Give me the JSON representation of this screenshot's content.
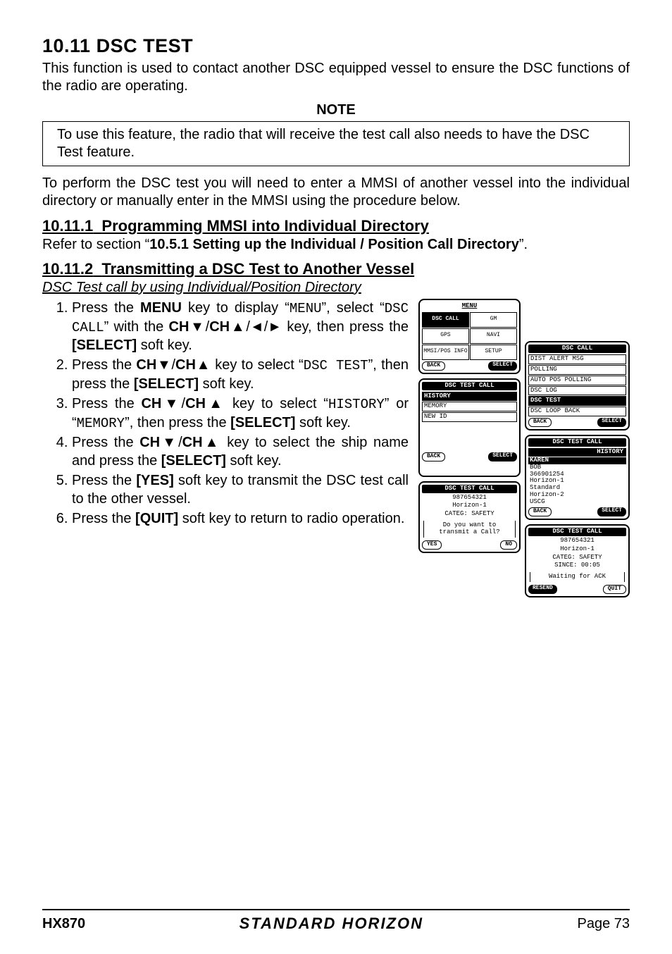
{
  "section": {
    "number": "10.11",
    "title": "DSC TEST",
    "intro": "This function is used to contact another DSC equipped vessel to ensure the DSC functions of the radio are operating."
  },
  "note": {
    "label": "NOTE",
    "text": "To use this feature, the radio that will receive the test call also needs to have the DSC Test feature."
  },
  "intro2": "To perform the DSC test you will need to enter a MMSI of another vessel into the individual directory or manually enter in the MMSI using the procedure below.",
  "sub1": {
    "number": "10.11.1",
    "title": "Programming MMSI into Individual Directory",
    "refer_pre": "Refer to section “",
    "refer_bold": "10.5.1  Setting up the Individual / Position Call Directory",
    "refer_post": "”."
  },
  "sub2": {
    "number": "10.11.2",
    "title": "Transmitting a DSC Test to Another Vessel",
    "subtitle": "DSC Test call by using Individual/Position Directory"
  },
  "steps": {
    "s1a": "Press the ",
    "s1b": "MENU",
    "s1c": " key to display “",
    "s1d": "MENU",
    "s1e": "”, select “",
    "s1f": "DSC CALL",
    "s1g": "” with the ",
    "s1h": "CH▼",
    "s1i": "/",
    "s1j": "CH▲",
    "s1k": "/◄/► key, then press the ",
    "s1l": "[SELECT]",
    "s1m": " soft key.",
    "s2a": "Press the ",
    "s2b": "CH▼",
    "s2c": "/",
    "s2d": "CH▲",
    "s2e": " key to select “",
    "s2f": "DSC TEST",
    "s2g": "”, then press the ",
    "s2h": "[SELECT]",
    "s2i": " soft key.",
    "s3a": "Press the ",
    "s3b": "CH▼",
    "s3c": "/",
    "s3d": "CH▲",
    "s3e": " key to select “",
    "s3f": "HISTORY",
    "s3g": "” or “",
    "s3h": "MEMORY",
    "s3i": "”, then press the ",
    "s3j": "[SELECT]",
    "s3k": " soft key.",
    "s4a": "Press the ",
    "s4b": "CH▼",
    "s4c": "/",
    "s4d": "CH▲",
    "s4e": " key to select the ship name and press the ",
    "s4f": "[SELECT]",
    "s4g": " soft key.",
    "s5a": "Press the ",
    "s5b": "[YES]",
    "s5c": " soft key to transmit the DSC test call to the other vessel.",
    "s6a": "Press the ",
    "s6b": "[QUIT]",
    "s6c": " soft key to return to radio operation."
  },
  "lcd": {
    "menu": {
      "title": "MENU",
      "cells": [
        "DSC CALL",
        "GM",
        "GPS",
        "NAVI",
        "MMSI/POS INFO",
        "SETUP"
      ],
      "back": "BACK",
      "select": "SELECT"
    },
    "dsc_call": {
      "title": "DSC CALL",
      "items": [
        "DIST ALERT MSG",
        "POLLING",
        "AUTO POS POLLING",
        "DSC LOG",
        "DSC TEST",
        "DSC LOOP BACK"
      ],
      "selected_index": 4,
      "back": "BACK",
      "select": "SELECT"
    },
    "test_call_menu": {
      "title": "DSC TEST CALL",
      "items": [
        "HISTORY",
        "MEMORY",
        "NEW ID"
      ],
      "selected_index": 0,
      "back": "BACK",
      "select": "SELECT"
    },
    "history": {
      "title": "DSC TEST CALL",
      "sub": "HISTORY",
      "items": [
        "KAREN",
        "BOB",
        "366901254",
        "Horizon-1",
        "Standard",
        "Horizon-2",
        "USCG"
      ],
      "selected_index": 0,
      "back": "BACK",
      "select": "SELECT"
    },
    "confirm": {
      "title": "DSC TEST CALL",
      "l1": "987654321",
      "l2": "Horizon-1",
      "l3": "CATEG: SAFETY",
      "q1": "Do you want to",
      "q2": "transmit a Call?",
      "yes": "YES",
      "no": "NO"
    },
    "waiting": {
      "title": "DSC TEST CALL",
      "l1": "987654321",
      "l2": "Horizon-1",
      "l3": "CATEG: SAFETY",
      "since": "SINCE: 00:05",
      "msg": "Waiting for ACK",
      "resend": "RESEND",
      "quit": "QUIT"
    }
  },
  "footer": {
    "left": "HX870",
    "center": "STANDARD HORIZON",
    "right": "Page 73"
  }
}
